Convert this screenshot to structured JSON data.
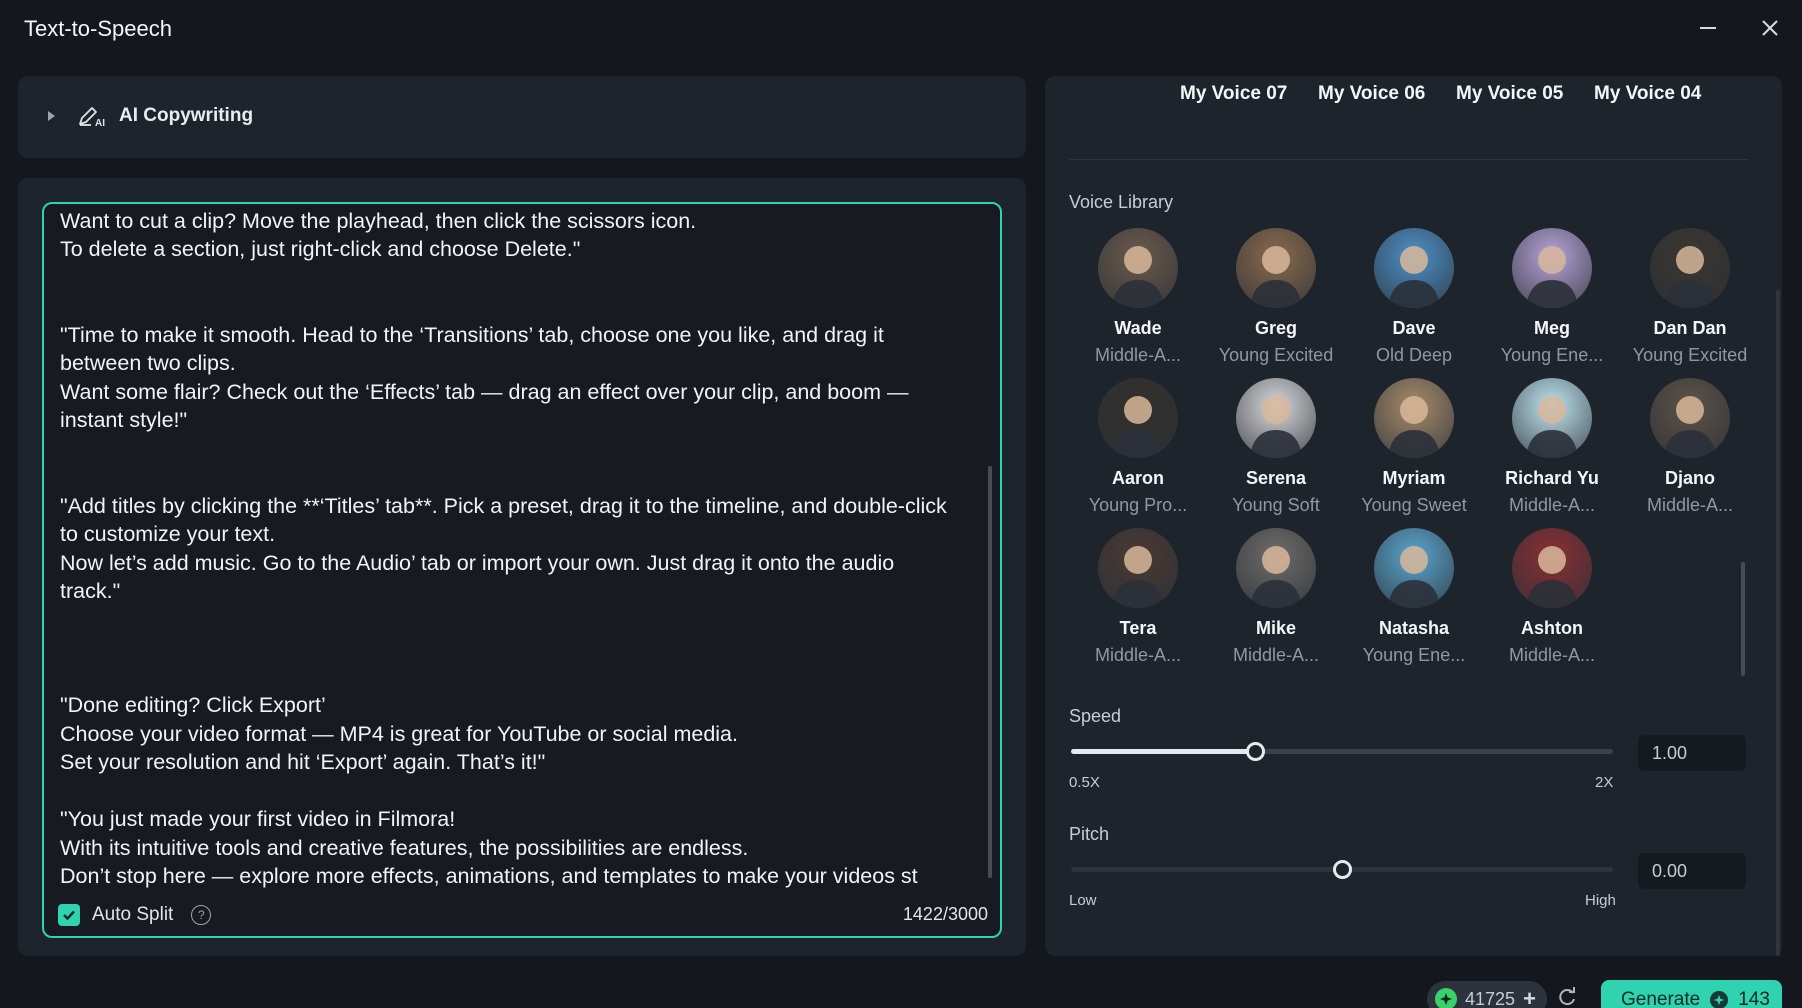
{
  "window": {
    "title": "Text-to-Speech"
  },
  "ai_copywriting": {
    "label": "AI Copywriting"
  },
  "editor": {
    "text": "\"Let's edit. Drag your video onto the timeline.\nWant to cut a clip? Move the playhead, then click the scissors icon.\nTo delete a section, just right-click and choose Delete.\"\n\n\n\"Time to make it smooth. Head to the ‘Transitions’ tab, choose one you like, and drag it between two clips.\nWant some flair? Check out the ‘Effects’ tab — drag an effect over your clip, and boom — instant style!\"\n\n\n\"Add titles by clicking the **‘Titles’ tab**. Pick a preset, drag it to the timeline, and double-click to customize your text.\nNow let’s add music. Go to the Audio’ tab or import your own. Just drag it onto the audio track.\"\n\n\n\n\"Done editing? Click Export’\nChoose your video format — MP4 is great for YouTube or social media.\nSet your resolution and hit ‘Export’ again. That’s it!\"\n\n\"You just made your first video in Filmora!\nWith its intuitive tools and creative features, the possibilities are endless.\nDon’t stop here — explore more effects, animations, and templates to make your videos st",
    "auto_split_label": "Auto Split",
    "auto_split_checked": true,
    "char_count": "1422/3000"
  },
  "tabs": [
    {
      "label": "My Voice 07"
    },
    {
      "label": "My Voice 06"
    },
    {
      "label": "My Voice 05"
    },
    {
      "label": "My Voice 04"
    }
  ],
  "voice_library": {
    "title": "Voice Library",
    "voices": [
      {
        "name": "Wade",
        "desc": "Middle-A...",
        "color": "#6b5a4c"
      },
      {
        "name": "Greg",
        "desc": "Young Excited",
        "color": "#8a6a4e"
      },
      {
        "name": "Dave",
        "desc": "Old Deep",
        "color": "#4d90c8"
      },
      {
        "name": "Meg",
        "desc": "Young Ene...",
        "color": "#b7a3d8"
      },
      {
        "name": "Dan Dan",
        "desc": "Young Excited",
        "color": "#3c3630"
      },
      {
        "name": "Aaron",
        "desc": "Young Pro...",
        "color": "#33302c"
      },
      {
        "name": "Serena",
        "desc": "Young Soft",
        "color": "#d9d9dc"
      },
      {
        "name": "Myriam",
        "desc": "Young Sweet",
        "color": "#a68b6b"
      },
      {
        "name": "Richard Yu",
        "desc": "Middle-A...",
        "color": "#bfe4f0"
      },
      {
        "name": "Djano",
        "desc": "Middle-A...",
        "color": "#5e5248"
      },
      {
        "name": "Tera",
        "desc": "Middle-A...",
        "color": "#4a3a33"
      },
      {
        "name": "Mike",
        "desc": "Middle-A...",
        "color": "#6f6c6a"
      },
      {
        "name": "Natasha",
        "desc": "Young Ene...",
        "color": "#5aa6cf"
      },
      {
        "name": "Ashton",
        "desc": "Middle-A...",
        "color": "#8a2f35"
      }
    ]
  },
  "speed": {
    "label": "Speed",
    "min_label": "0.5X",
    "max_label": "2X",
    "value": "1.00",
    "fraction": 0.34
  },
  "pitch": {
    "label": "Pitch",
    "min_label": "Low",
    "max_label": "High",
    "value": "0.00",
    "fraction": 0.5
  },
  "footer": {
    "credits": "41725",
    "generate_label": "Generate",
    "generate_cost": "143"
  },
  "colors": {
    "accent": "#2fd3b0",
    "background": "#14181e",
    "panel": "#1e242c",
    "credit": "#3ad16a"
  }
}
